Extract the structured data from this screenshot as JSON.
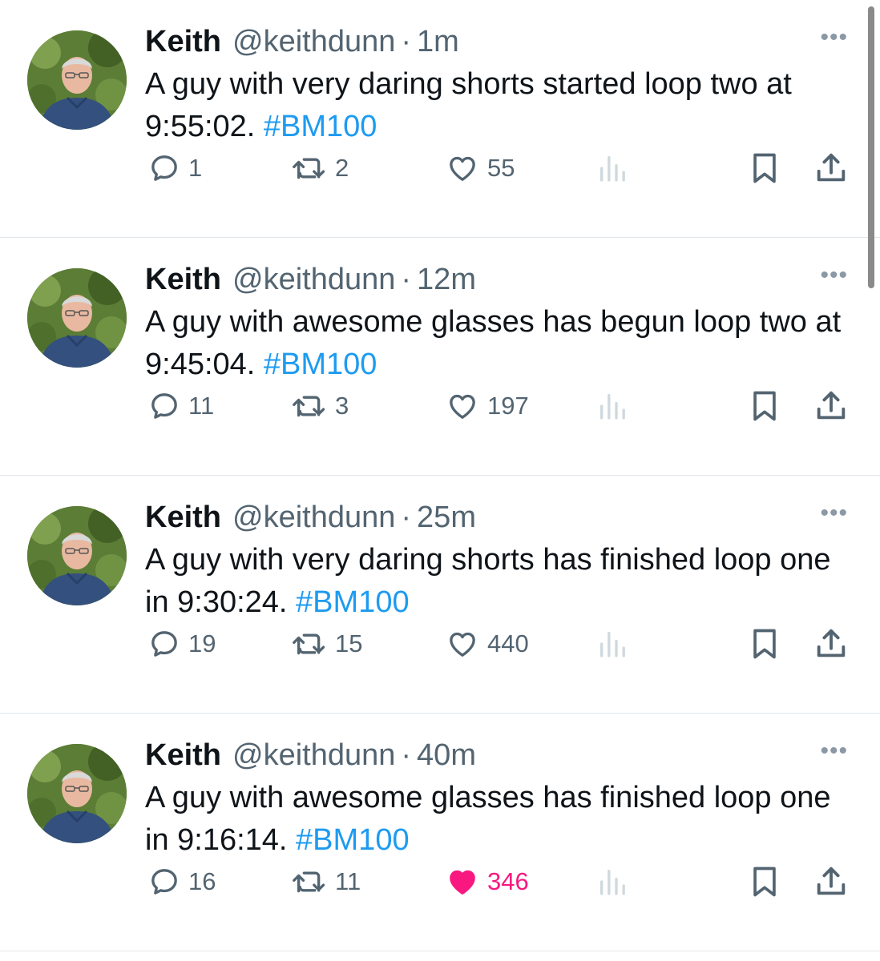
{
  "tweets": [
    {
      "name": "Keith",
      "handle": "@keithdunn",
      "separator": "·",
      "time": "1m",
      "text_prefix": "A guy with very daring shorts started loop two at 9:55:02. ",
      "hashtag": "#BM100",
      "replies": "1",
      "retweets": "2",
      "likes": "55",
      "liked": false,
      "more": "•••"
    },
    {
      "name": "Keith",
      "handle": "@keithdunn",
      "separator": "·",
      "time": "12m",
      "text_prefix": "A guy with awesome glasses has begun loop two at 9:45:04. ",
      "hashtag": "#BM100",
      "replies": "11",
      "retweets": "3",
      "likes": "197",
      "liked": false,
      "more": "•••"
    },
    {
      "name": "Keith",
      "handle": "@keithdunn",
      "separator": "·",
      "time": "25m",
      "text_prefix": "A guy with very daring shorts has finished loop one in 9:30:24. ",
      "hashtag": "#BM100",
      "replies": "19",
      "retweets": "15",
      "likes": "440",
      "liked": false,
      "more": "•••"
    },
    {
      "name": "Keith",
      "handle": "@keithdunn",
      "separator": "·",
      "time": "40m",
      "text_prefix": "A guy with awesome glasses has finished loop one in 9:16:14. ",
      "hashtag": "#BM100",
      "replies": "16",
      "retweets": "11",
      "likes": "346",
      "liked": true,
      "more": "•••"
    }
  ],
  "icons": {
    "reply": "speech-bubble-icon",
    "retweet": "retweet-arrows-icon",
    "like": "heart-icon",
    "views": "bar-chart-icon",
    "bookmark": "bookmark-icon",
    "share": "share-upload-icon",
    "more": "more-dots-icon"
  },
  "colors": {
    "hashtag": "#1d9bf0",
    "secondary_text": "#536471",
    "like_active": "#f91880",
    "divider": "#e1e6ea"
  }
}
